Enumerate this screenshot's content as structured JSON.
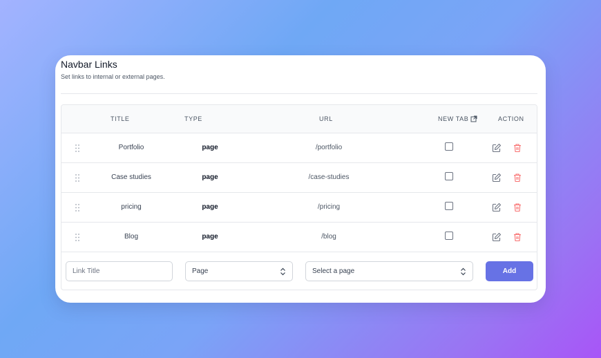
{
  "panel": {
    "title": "Navbar Links",
    "subtitle": "Set links to internal or external pages."
  },
  "table": {
    "headers": {
      "title": "TITLE",
      "type": "TYPE",
      "url": "URL",
      "new_tab": "NEW TAB",
      "action": "ACTION"
    },
    "rows": [
      {
        "title": "Portfolio",
        "type": "page",
        "url": "/portfolio",
        "new_tab": false
      },
      {
        "title": "Case studies",
        "type": "page",
        "url": "/case-studies",
        "new_tab": false
      },
      {
        "title": "pricing",
        "type": "page",
        "url": "/pricing",
        "new_tab": false
      },
      {
        "title": "Blog",
        "type": "page",
        "url": "/blog",
        "new_tab": false
      }
    ]
  },
  "form": {
    "title_placeholder": "Link Title",
    "type_value": "Page",
    "page_value": "Select a page",
    "add_label": "Add"
  },
  "icons": {
    "drag": "drag-handle-icon",
    "external": "external-link-icon",
    "edit": "pencil-icon",
    "delete": "trash-icon",
    "caret": "chevron-up-down-icon"
  },
  "colors": {
    "accent": "#6772e5",
    "danger": "#f87171",
    "edit": "#6b7280"
  }
}
